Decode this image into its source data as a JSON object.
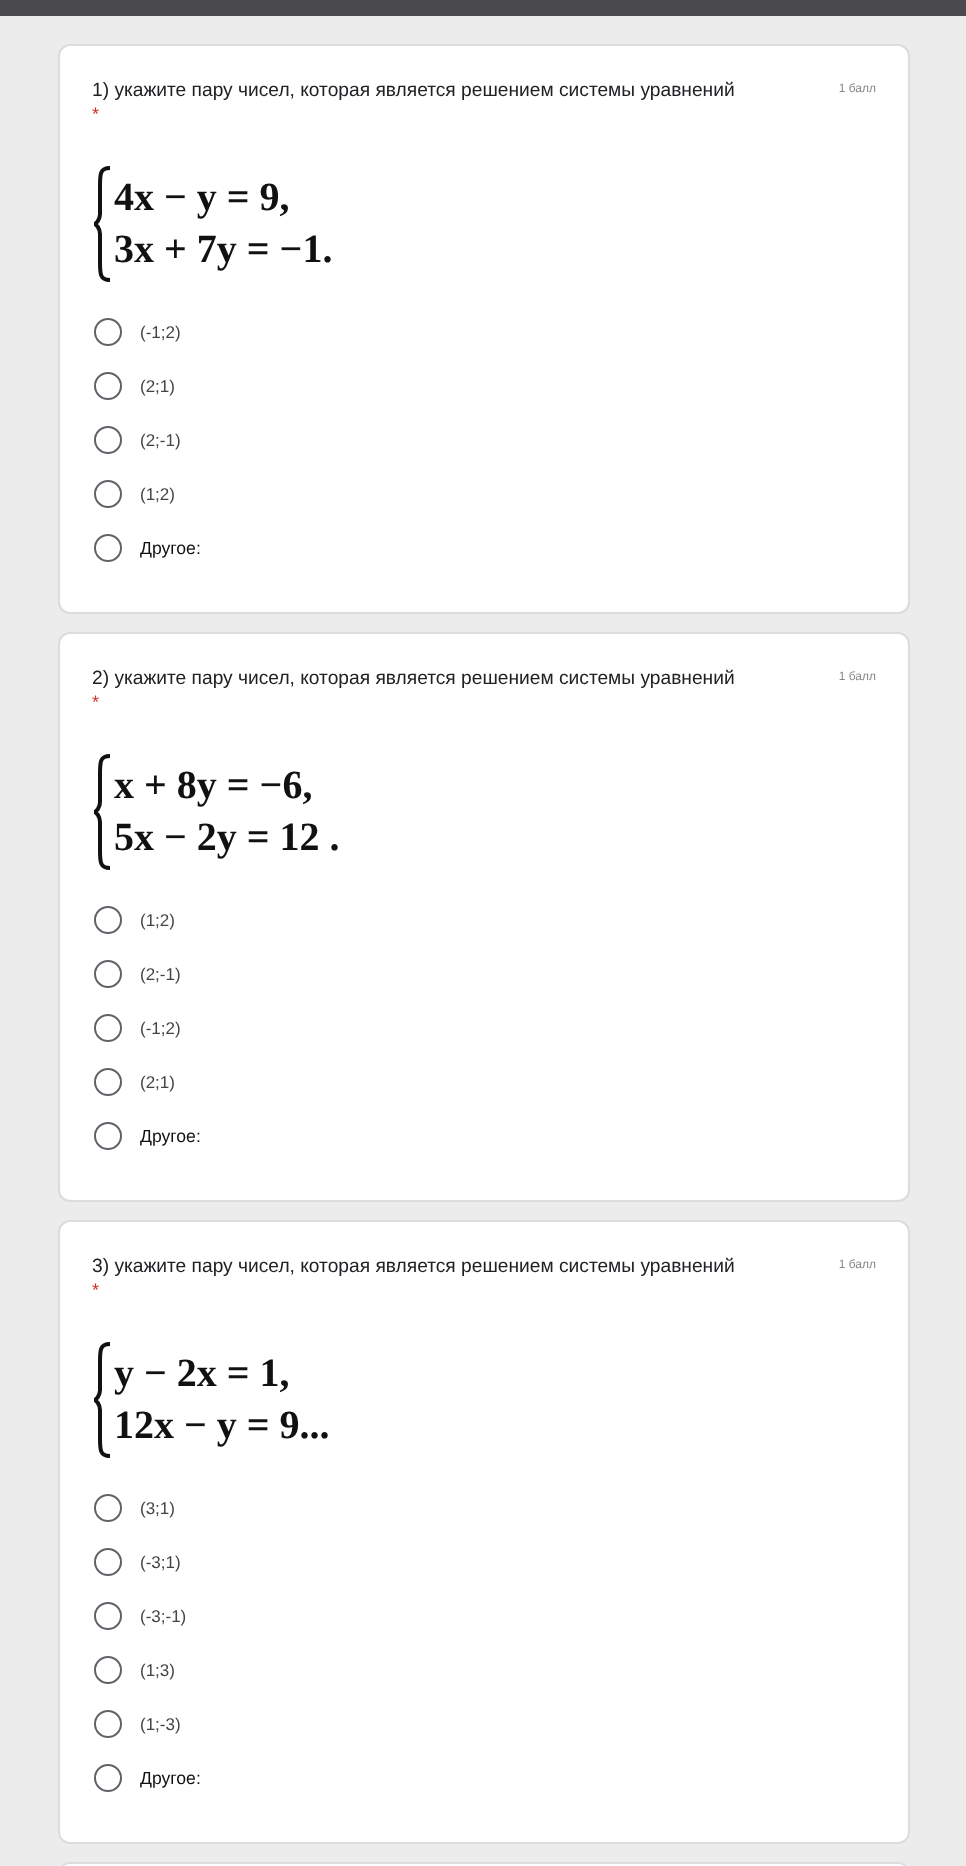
{
  "questions": [
    {
      "title": "1) укажите пару чисел, которая является решением системы уравнений",
      "points": "1 балл",
      "required_mark": "*",
      "equation": [
        "4x − y = 9,",
        "3x + 7y = −1."
      ],
      "options": [
        {
          "label": "(-1;2)",
          "kind": "choice",
          "selected": false
        },
        {
          "label": "(2;1)",
          "kind": "choice",
          "selected": false
        },
        {
          "label": "(2;-1)",
          "kind": "choice",
          "selected": false
        },
        {
          "label": "(1;2)",
          "kind": "choice",
          "selected": false
        },
        {
          "label": "Другое:",
          "kind": "other",
          "selected": false
        }
      ]
    },
    {
      "title": "2) укажите пару чисел, которая является решением системы уравнений",
      "points": "1 балл",
      "required_mark": "*",
      "equation": [
        "x + 8y = −6,",
        "5x − 2y = 12 ."
      ],
      "options": [
        {
          "label": "(1;2)",
          "kind": "choice",
          "selected": false
        },
        {
          "label": "(2;-1)",
          "kind": "choice",
          "selected": false
        },
        {
          "label": "(-1;2)",
          "kind": "choice",
          "selected": false
        },
        {
          "label": "(2;1)",
          "kind": "choice",
          "selected": false
        },
        {
          "label": "Другое:",
          "kind": "other",
          "selected": false
        }
      ]
    },
    {
      "title": "3) укажите пару чисел, которая является решением системы уравнений",
      "points": "1 балл",
      "required_mark": "*",
      "equation": [
        "y − 2x = 1,",
        "12x − y = 9..."
      ],
      "options": [
        {
          "label": "(3;1)",
          "kind": "choice",
          "selected": false
        },
        {
          "label": "(-3;1)",
          "kind": "choice",
          "selected": false
        },
        {
          "label": "(-3;-1)",
          "kind": "choice",
          "selected": false
        },
        {
          "label": "(1;3)",
          "kind": "choice",
          "selected": false
        },
        {
          "label": "(1;-3)",
          "kind": "choice",
          "selected": false
        },
        {
          "label": "Другое:",
          "kind": "other",
          "selected": false
        }
      ]
    }
  ]
}
